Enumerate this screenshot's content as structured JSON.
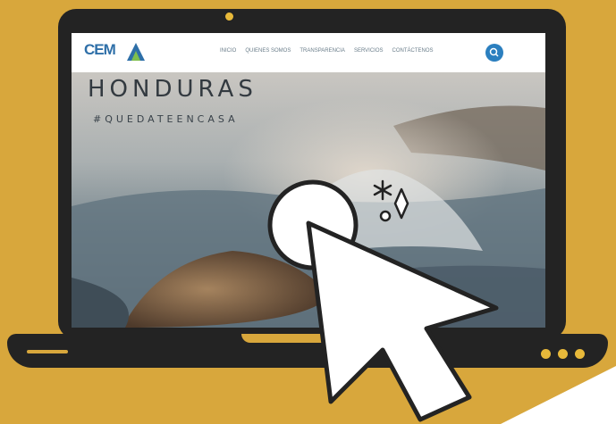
{
  "website": {
    "logo": "CEM",
    "nav_items": [
      "INICIO",
      "QUIENES SOMOS",
      "TRANSPARENCIA",
      "SERVICIOS",
      "CONTÁCTENOS"
    ],
    "hero_title": "HONDURAS",
    "hero_tag": "#QUEDATEENCASA"
  },
  "colors": {
    "background": "#d8a73c",
    "laptop": "#232323",
    "accent_dots": "#e8b93a",
    "logo": "#2e6fa8",
    "search_button": "#2b7fbf"
  },
  "icons": [
    "camera",
    "search",
    "cursor-arrow",
    "click-circle",
    "sparkle-asterisk",
    "sparkle-diamond",
    "sparkle-circle"
  ]
}
